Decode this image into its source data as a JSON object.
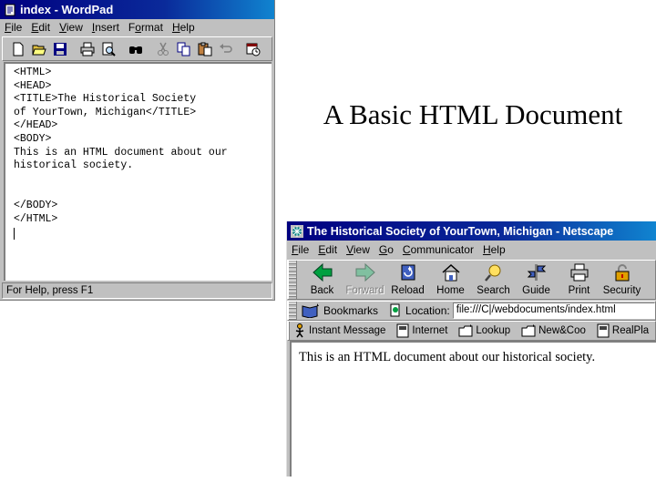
{
  "wordpad": {
    "title": "index - WordPad",
    "menu": [
      {
        "ul": "F",
        "rest": "ile"
      },
      {
        "ul": "E",
        "rest": "dit"
      },
      {
        "ul": "V",
        "rest": "iew"
      },
      {
        "ul": "I",
        "rest": "nsert"
      },
      {
        "pre": "F",
        "ul": "o",
        "rest": "rmat"
      },
      {
        "ul": "H",
        "rest": "elp"
      }
    ],
    "toolbar_icons": [
      "new-icon",
      "open-icon",
      "save-icon",
      "print-icon",
      "print-preview-icon",
      "find-icon",
      "cut-icon",
      "copy-icon",
      "paste-icon",
      "undo-icon",
      "date-time-icon"
    ],
    "code": "<HTML>\n<HEAD>\n<TITLE>The Historical Society\nof YourTown, Michigan</TITLE>\n</HEAD>\n<BODY>\nThis is an HTML document about our\nhistorical society.\n\n\n</BODY>\n</HTML>",
    "status": "For Help, press F1"
  },
  "slide": {
    "title": "A Basic HTML Document"
  },
  "netscape": {
    "title": "The Historical Society of YourTown, Michigan - Netscape",
    "menu": [
      {
        "ul": "F",
        "rest": "ile"
      },
      {
        "ul": "E",
        "rest": "dit"
      },
      {
        "ul": "V",
        "rest": "iew"
      },
      {
        "ul": "G",
        "rest": "o"
      },
      {
        "ul": "C",
        "rest": "ommunicator"
      },
      {
        "ul": "H",
        "rest": "elp"
      }
    ],
    "nav": {
      "back": "Back",
      "forward": "Forward",
      "reload": "Reload",
      "home": "Home",
      "search": "Search",
      "guide": "Guide",
      "print": "Print",
      "security": "Security"
    },
    "bookmarks": "Bookmarks",
    "location_label": "Location:",
    "url": "file:///C|/webdocuments/index.html",
    "personal": {
      "instant_message": "Instant Message",
      "internet": "Internet",
      "lookup": "Lookup",
      "newcool": "New&Coo",
      "realplayer": "RealPla"
    },
    "content": "This is an HTML document about our historical society."
  }
}
